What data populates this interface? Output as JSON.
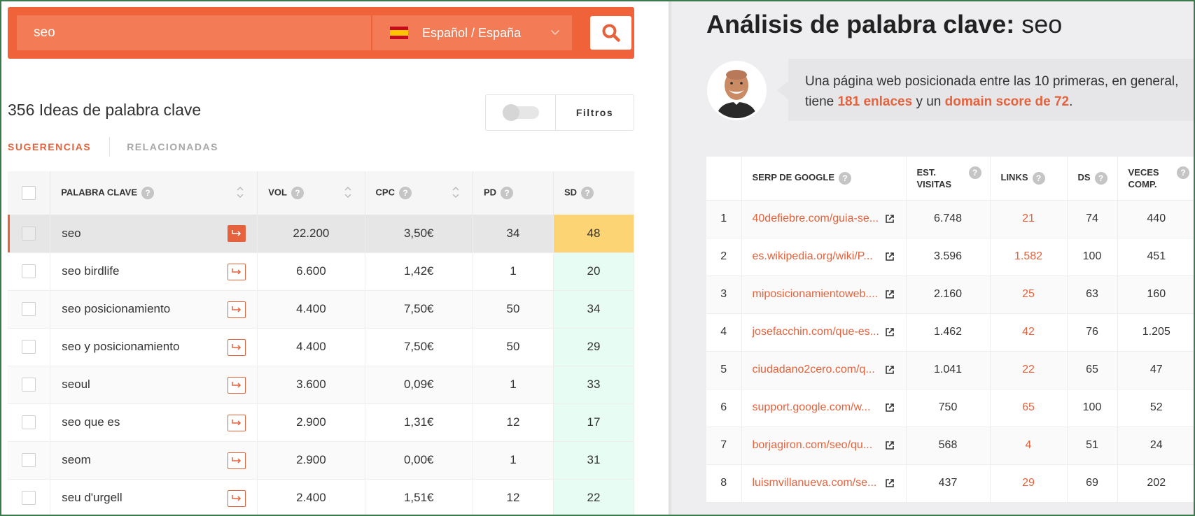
{
  "search": {
    "query": "seo",
    "language": "Español / España",
    "flag": "spain-flag"
  },
  "ideas": {
    "title": "356 Ideas de palabra clave",
    "filters_label": "Filtros"
  },
  "tabs": [
    {
      "label": "SUGERENCIAS",
      "active": true
    },
    {
      "label": "RELACIONADAS",
      "active": false
    }
  ],
  "kw_table": {
    "headers": {
      "keyword": "PALABRA CLAVE",
      "vol": "VOL",
      "cpc": "CPC",
      "pd": "PD",
      "sd": "SD"
    },
    "rows": [
      {
        "keyword": "seo",
        "vol": "22.200",
        "cpc": "3,50€",
        "pd": "34",
        "sd": "48",
        "selected": true
      },
      {
        "keyword": "seo birdlife",
        "vol": "6.600",
        "cpc": "1,42€",
        "pd": "1",
        "sd": "20"
      },
      {
        "keyword": "seo posicionamiento",
        "vol": "4.400",
        "cpc": "7,50€",
        "pd": "50",
        "sd": "34"
      },
      {
        "keyword": "seo y posicionamiento",
        "vol": "4.400",
        "cpc": "7,50€",
        "pd": "50",
        "sd": "29"
      },
      {
        "keyword": "seoul",
        "vol": "3.600",
        "cpc": "0,09€",
        "pd": "1",
        "sd": "33"
      },
      {
        "keyword": "seo que es",
        "vol": "2.900",
        "cpc": "1,31€",
        "pd": "12",
        "sd": "17"
      },
      {
        "keyword": "seom",
        "vol": "2.900",
        "cpc": "0,00€",
        "pd": "1",
        "sd": "31"
      },
      {
        "keyword": "seu d'urgell",
        "vol": "2.400",
        "cpc": "1,51€",
        "pd": "12",
        "sd": "22"
      }
    ]
  },
  "analysis": {
    "title_prefix": "Análisis de palabra clave:",
    "keyword": "seo",
    "bubble": {
      "pre": "Una página web posicionada entre las 10 primeras, en general, tiene ",
      "links": "181 enlaces",
      "mid": " y un ",
      "ds": "domain score de 72",
      "post": "."
    }
  },
  "serp_table": {
    "headers": {
      "serp": "SERP DE GOOGLE",
      "visits_1": "EST.",
      "visits_2": "VISITAS",
      "links": "LINKS",
      "ds": "DS",
      "shares_1": "VECES",
      "shares_2": "COMP."
    },
    "rows": [
      {
        "rank": "1",
        "url": "40defiebre.com/guia-se...",
        "visits": "6.748",
        "links": "21",
        "ds": "74",
        "shares": "440"
      },
      {
        "rank": "2",
        "url": "es.wikipedia.org/wiki/P...",
        "visits": "3.596",
        "links": "1.582",
        "ds": "100",
        "shares": "451"
      },
      {
        "rank": "3",
        "url": "miposicionamientoweb....",
        "visits": "2.160",
        "links": "25",
        "ds": "63",
        "shares": "160"
      },
      {
        "rank": "4",
        "url": "josefacchin.com/que-es...",
        "visits": "1.462",
        "links": "42",
        "ds": "76",
        "shares": "1.205"
      },
      {
        "rank": "5",
        "url": "ciudadano2cero.com/q...",
        "visits": "1.041",
        "links": "22",
        "ds": "65",
        "shares": "47"
      },
      {
        "rank": "6",
        "url": "support.google.com/w...",
        "visits": "750",
        "links": "65",
        "ds": "100",
        "shares": "52"
      },
      {
        "rank": "7",
        "url": "borjagiron.com/seo/qu...",
        "visits": "568",
        "links": "4",
        "ds": "51",
        "shares": "24"
      },
      {
        "rank": "8",
        "url": "luismvillanueva.com/se...",
        "visits": "437",
        "links": "29",
        "ds": "69",
        "shares": "202"
      }
    ]
  },
  "colors": {
    "accent": "#e5623c",
    "search_bg": "#f0633a",
    "sd_low": "#e7fcf3",
    "sd_mid": "#fcd474"
  }
}
